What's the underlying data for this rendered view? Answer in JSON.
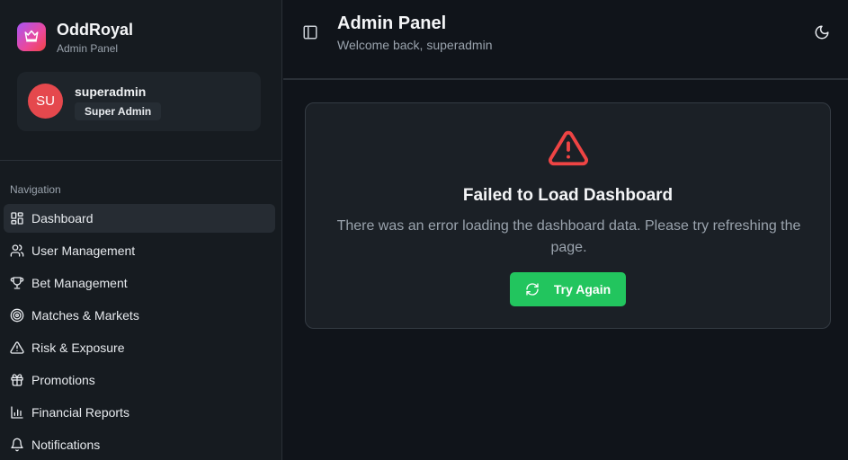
{
  "brand": {
    "name": "OddRoyal",
    "subtitle": "Admin Panel",
    "logo_icon": "crown-icon"
  },
  "user": {
    "initials": "SU",
    "name": "superadmin",
    "role": "Super Admin"
  },
  "navigation": {
    "heading": "Navigation",
    "items": [
      {
        "label": "Dashboard",
        "icon": "dashboard-icon",
        "active": true
      },
      {
        "label": "User Management",
        "icon": "users-icon",
        "active": false
      },
      {
        "label": "Bet Management",
        "icon": "trophy-icon",
        "active": false
      },
      {
        "label": "Matches & Markets",
        "icon": "target-icon",
        "active": false
      },
      {
        "label": "Risk & Exposure",
        "icon": "warning-icon",
        "active": false
      },
      {
        "label": "Promotions",
        "icon": "gift-icon",
        "active": false
      },
      {
        "label": "Financial Reports",
        "icon": "bar-chart-icon",
        "active": false
      },
      {
        "label": "Notifications",
        "icon": "bell-icon",
        "active": false
      }
    ]
  },
  "header": {
    "title": "Admin Panel",
    "subtitle": "Welcome back, superadmin"
  },
  "error": {
    "title": "Failed to Load Dashboard",
    "message": "There was an error loading the dashboard data. Please try refreshing the page.",
    "button_label": "Try Again"
  },
  "colors": {
    "accent_green": "#22c55e",
    "error_red": "#ef4444",
    "avatar_red": "#e5484d"
  }
}
